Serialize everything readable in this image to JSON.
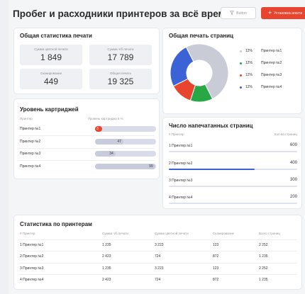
{
  "header": {
    "title": "Пробег и расходники принтеров за всё время",
    "filter_label": "Button",
    "primary_label": "Установка агента"
  },
  "stats": {
    "title": "Общая статистика печати",
    "items": [
      {
        "label": "Сумма цветной печати",
        "value": "1 849"
      },
      {
        "label": "Сумма ч/б печати",
        "value": "17 789"
      },
      {
        "label": "Сканирование",
        "value": "449"
      },
      {
        "label": "Общая печать",
        "value": "19 325"
      }
    ]
  },
  "pie": {
    "title": "Общая печать страниц",
    "slices": [
      {
        "pct": "12%",
        "name": "Принтер №1",
        "color": "#c9ccd6",
        "value": 12
      },
      {
        "pct": "12%",
        "name": "Принтер №2",
        "color": "#27a745",
        "value": 12
      },
      {
        "pct": "12%",
        "name": "Принтер №3",
        "color": "#e8452e",
        "value": 12
      },
      {
        "pct": "12%",
        "name": "Принтер №4",
        "color": "#3b63d6",
        "value": 12
      }
    ]
  },
  "cartridge": {
    "title": "Уровень картриджей",
    "col_printer": "Принтер",
    "col_level": "Уровень картриджа в %",
    "rows": [
      {
        "name": "Принтер №1",
        "level": 3,
        "label": "3"
      },
      {
        "name": "Принтер №2",
        "level": 47,
        "label": "47"
      },
      {
        "name": "Принтер №3",
        "level": 34,
        "label": "34"
      },
      {
        "name": "Принтер №4",
        "level": 99,
        "label": "99"
      }
    ]
  },
  "pages": {
    "title": "Число напечатанных страниц",
    "col_printer": "# Принтер",
    "col_count": "Кол-во страниц",
    "rows": [
      {
        "num": "1",
        "name": "Принтер №1",
        "value": "600",
        "fill": 0
      },
      {
        "num": "2",
        "name": "Принтер №2",
        "value": "400",
        "fill": 0.67
      },
      {
        "num": "3",
        "name": "Принтер №3",
        "value": "300",
        "fill": 0
      },
      {
        "num": "4",
        "name": "Принтер №4",
        "value": "200",
        "fill": 0
      }
    ]
  },
  "table": {
    "title": "Статистика по принтерам",
    "headers": [
      "# Принтер",
      "Сумма ч/б печати",
      "Сумма цветной печати",
      "Сканирование",
      "Всего страниц"
    ],
    "rows": [
      [
        "1",
        "Принтер №1",
        "1 235",
        "3 223",
        "123",
        "2 252"
      ],
      [
        "2",
        "Принтер №2",
        "2 423",
        "724",
        "872",
        "1 235"
      ],
      [
        "3",
        "Принтер №3",
        "1 235",
        "3 223",
        "123",
        "2 252"
      ],
      [
        "4",
        "Принтер №4",
        "2 423",
        "724",
        "872",
        "1 235"
      ]
    ]
  }
}
